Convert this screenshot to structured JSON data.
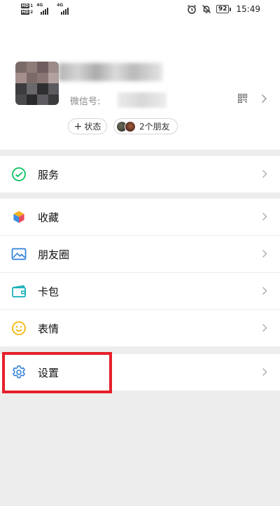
{
  "status_bar": {
    "sim1_tag": "HD",
    "sim1_num": "1",
    "sim2_tag": "HD",
    "sim2_num": "2",
    "net1": "4G",
    "net2": "4G",
    "battery": "92",
    "time": "15:49",
    "icons": [
      "alarm-icon",
      "bell-muted-icon",
      "battery-icon"
    ]
  },
  "profile": {
    "wechat_id_label": "微信号:",
    "status_button": {
      "icon": "+",
      "label": "状态"
    },
    "friends_button": {
      "label": "2个朋友"
    }
  },
  "menu": {
    "services": {
      "label": "服务",
      "icon": "wallet-icon",
      "color": "#07c160"
    },
    "favorites": {
      "label": "收藏",
      "icon": "cube-icon"
    },
    "moments": {
      "label": "朋友圈",
      "icon": "picture-icon",
      "color": "#2f7fd8"
    },
    "cards": {
      "label": "卡包",
      "icon": "card-icon",
      "color": "#10aeb5"
    },
    "stickers": {
      "label": "表情",
      "icon": "smiley-icon",
      "color": "#f2b80c"
    },
    "settings": {
      "label": "设置",
      "icon": "gear-icon",
      "color": "#2f7fd8"
    }
  },
  "highlight": {
    "target": "settings",
    "color": "#e5202a"
  }
}
